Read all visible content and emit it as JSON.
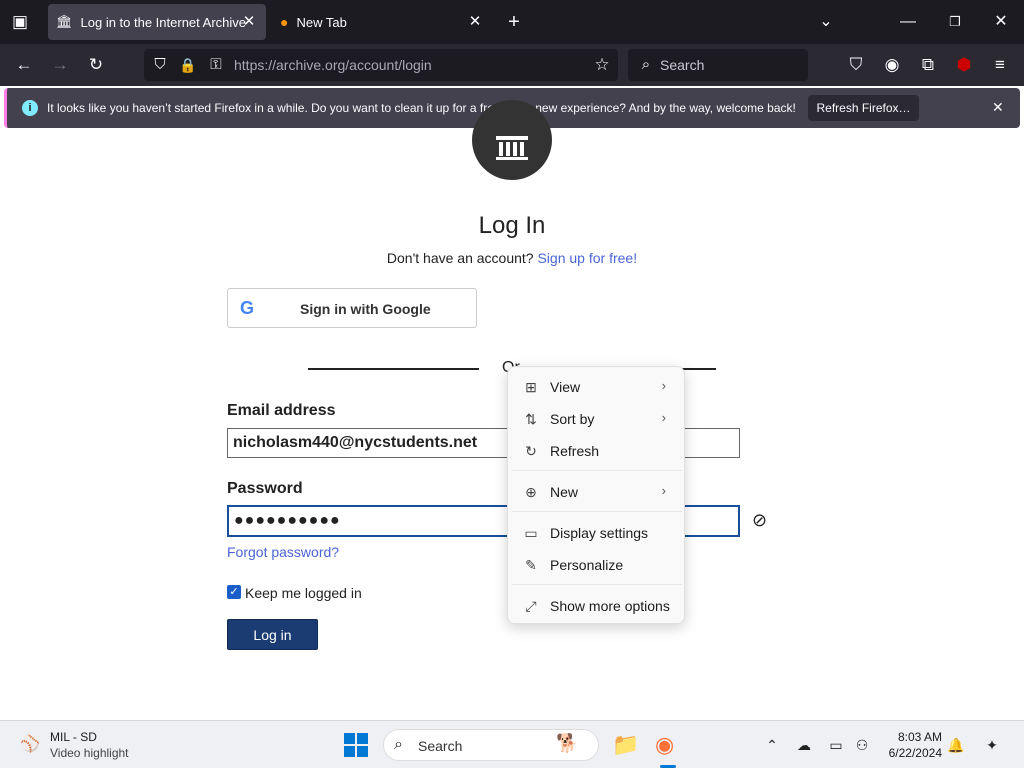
{
  "browser": {
    "tabs": [
      {
        "title": "Log in to the Internet Archive",
        "active": true
      },
      {
        "title": "New Tab",
        "active": false
      }
    ],
    "url_host": "https://archive.org",
    "url_path": "/account/login",
    "search_placeholder": "Search",
    "extension_badge": "8"
  },
  "notification": {
    "message": "It looks like you haven’t started Firefox in a while. Do you want to clean it up for a fresh, like-new experience? And by the way, welcome back!",
    "button": "Refresh Firefox…"
  },
  "page": {
    "heading": "Log In",
    "signup_prompt": "Don't have an account?",
    "signup_link": "Sign up for free!",
    "google_button": "Sign in with Google",
    "divider_text": "Or",
    "email_label": "Email address",
    "email_value": "nicholasm440@nycstudents.net",
    "password_label": "Password",
    "password_value": "●●●●●●●●●●",
    "forgot_link": "Forgot password?",
    "keep_logged_in": "Keep me logged in",
    "login_button": "Log in"
  },
  "context_menu": {
    "items": [
      {
        "label": "View",
        "icon": "grid-icon",
        "submenu": true
      },
      {
        "label": "Sort by",
        "icon": "sort-icon",
        "submenu": true
      },
      {
        "label": "Refresh",
        "icon": "refresh-icon",
        "submenu": false
      },
      {
        "label": "New",
        "icon": "plus-circle-icon",
        "submenu": true
      },
      {
        "label": "Display settings",
        "icon": "display-icon",
        "submenu": false
      },
      {
        "label": "Personalize",
        "icon": "pen-icon",
        "submenu": false
      },
      {
        "label": "Show more options",
        "icon": "expand-icon",
        "submenu": false
      }
    ]
  },
  "taskbar": {
    "news_title": "MIL - SD",
    "news_subtitle": "Video highlight",
    "search_text": "Search",
    "time": "8:03 AM",
    "date": "6/22/2024"
  }
}
